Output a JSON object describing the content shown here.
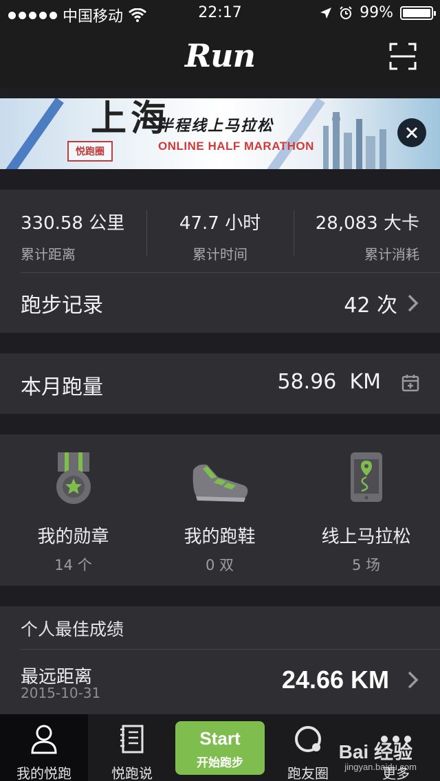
{
  "status_bar": {
    "carrier": "中国移动",
    "time": "22:17",
    "battery": "99%"
  },
  "nav": {
    "logo": "Run"
  },
  "banner": {
    "city": "上海",
    "seal": "悦跑圈",
    "subtitle_cn": "半程线上马拉松",
    "subtitle_en": "ONLINE HALF MARATHON"
  },
  "stats": {
    "distance": {
      "value": "330.58 公里",
      "label": "累计距离"
    },
    "time": {
      "value": "47.7 小时",
      "label": "累计时间"
    },
    "calories": {
      "value": "28,083 大卡",
      "label": "累计消耗"
    },
    "records": {
      "title": "跑步记录",
      "value": "42 次"
    }
  },
  "monthly": {
    "title": "本月跑量",
    "value": "58.96  KM"
  },
  "achievements": [
    {
      "name": "我的勋章",
      "count": "14 个",
      "icon": "medal-icon"
    },
    {
      "name": "我的跑鞋",
      "count": "0 双",
      "icon": "shoe-icon"
    },
    {
      "name": "线上马拉松",
      "count": "5 场",
      "icon": "phone-route-icon"
    }
  ],
  "personal_best": {
    "header": "个人最佳成绩",
    "title": "最远距离",
    "date": "2015-10-31",
    "value": "24.66 KM"
  },
  "tabs": {
    "my_run": "我的悦跑",
    "talk": "悦跑说",
    "start_en": "Start",
    "start_cn": "开始跑步",
    "friends": "跑友圈",
    "more": "更多"
  },
  "watermark": {
    "brand": "Bai 经验",
    "url": "jingyan.baidu.com"
  },
  "colors": {
    "accent_green": "#7fbd4f",
    "card_bg": "#2e2e33",
    "page_bg": "#1e1e22"
  }
}
